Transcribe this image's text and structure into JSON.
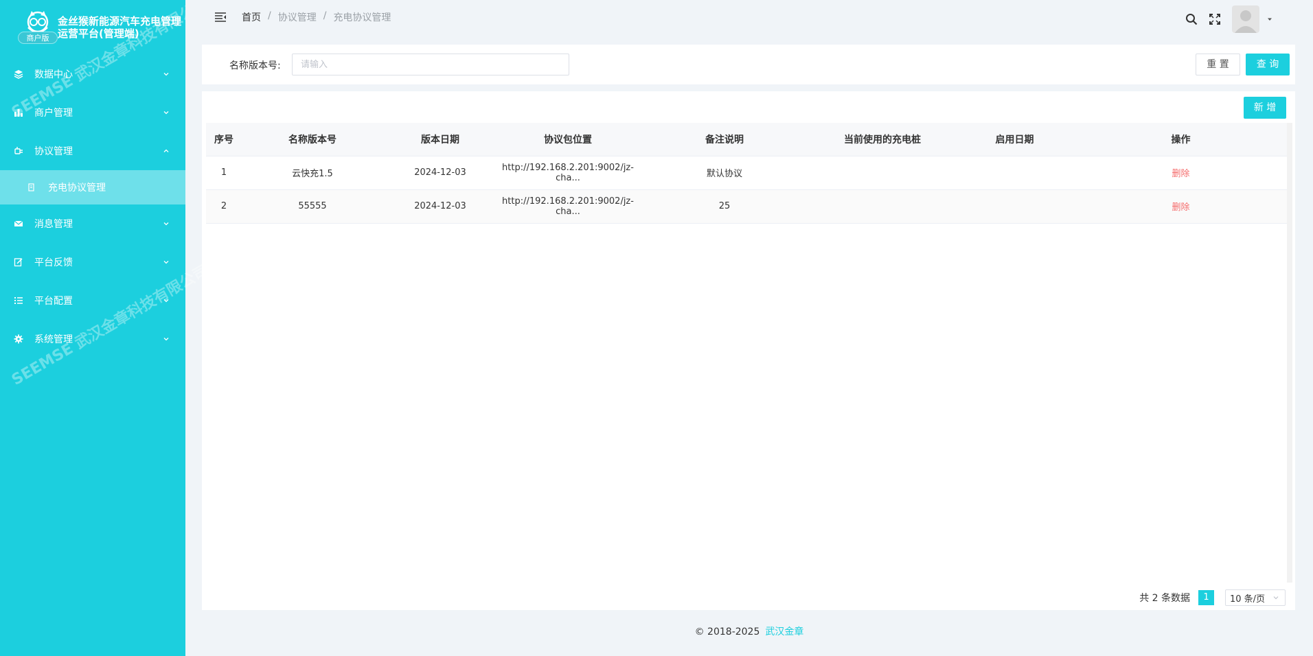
{
  "brand": {
    "title": "金丝猴新能源汽车充电管理运营平台(管理端)",
    "badge": "商户版"
  },
  "sidebar": {
    "items": [
      {
        "label": "数据中心",
        "icon": "layers-icon"
      },
      {
        "label": "商户管理",
        "icon": "bar-chart-icon"
      },
      {
        "label": "协议管理",
        "icon": "plug-icon",
        "expanded": true,
        "children": [
          {
            "label": "充电协议管理",
            "icon": "document-icon"
          }
        ]
      },
      {
        "label": "消息管理",
        "icon": "mail-icon"
      },
      {
        "label": "平台反馈",
        "icon": "edit-icon"
      },
      {
        "label": "平台配置",
        "icon": "list-icon"
      },
      {
        "label": "系统管理",
        "icon": "gear-icon"
      }
    ],
    "watermarks": [
      "SEEMSE 武汉金章科技有限公司",
      "SEEMSE 武汉金章科技有限公司"
    ]
  },
  "header": {
    "breadcrumb": [
      "首页",
      "协议管理",
      "充电协议管理"
    ],
    "separator": "/"
  },
  "search": {
    "label": "名称版本号:",
    "placeholder": "请输入",
    "value": "",
    "reset_label": "重 置",
    "query_label": "查 询"
  },
  "table": {
    "add_label": "新 增",
    "columns": [
      "序号",
      "名称版本号",
      "版本日期",
      "协议包位置",
      "备注说明",
      "当前使用的充电桩",
      "启用日期",
      "操作"
    ],
    "rows": [
      {
        "index": "1",
        "name": "云快充1.5",
        "date": "2024-12-03",
        "location": "http://192.168.2.201:9002/jz-cha...",
        "remark": "默认协议",
        "current_pile": "",
        "enable_date": "",
        "action": "删除"
      },
      {
        "index": "2",
        "name": "55555",
        "date": "2024-12-03",
        "location": "http://192.168.2.201:9002/jz-cha...",
        "remark": "25",
        "current_pile": "",
        "enable_date": "",
        "action": "删除"
      }
    ]
  },
  "pagination": {
    "total_text": "共 2 条数据",
    "current_page": "1",
    "page_size": "10 条/页"
  },
  "footer": {
    "copyright": "© 2018-2025",
    "company": "武汉金章"
  },
  "colors": {
    "accent": "#1ccfde",
    "sub_item_bg": "#6ee0ea",
    "danger": "#f56c6c"
  }
}
